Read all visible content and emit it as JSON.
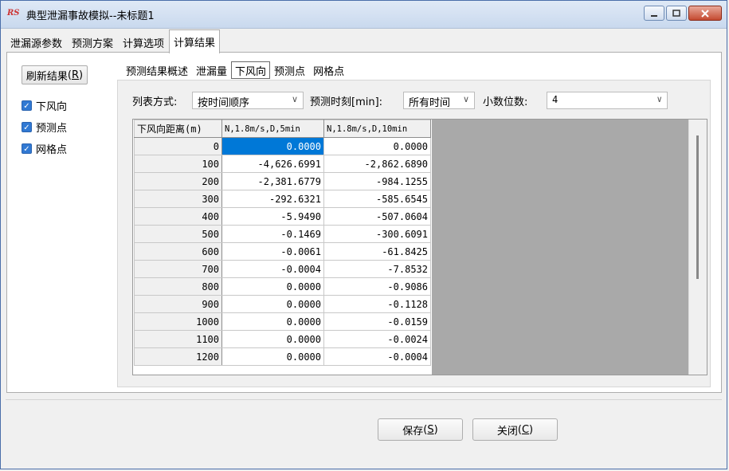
{
  "window": {
    "title": "典型泄漏事故模拟--未标题1",
    "logo": "RS"
  },
  "main_tabs": [
    "泄漏源参数",
    "预测方案",
    "计算选项",
    "计算结果"
  ],
  "active_main_tab": "计算结果",
  "left": {
    "refresh_label": "刷新结果",
    "refresh_hotkey": "R",
    "checkboxes": [
      {
        "label": "下风向",
        "checked": true
      },
      {
        "label": "预测点",
        "checked": true
      },
      {
        "label": "网格点",
        "checked": true
      }
    ]
  },
  "sub_tabs": [
    "预测结果概述",
    "泄漏量",
    "下风向",
    "预测点",
    "网格点"
  ],
  "active_sub_tab": "下风向",
  "options": {
    "list_mode_label": "列表方式:",
    "list_mode_value": "按时间顺序",
    "time_label": "预测时刻[min]:",
    "time_value": "所有时间",
    "decimals_label": "小数位数:",
    "decimals_value": "4"
  },
  "table": {
    "columns": [
      "下风向距离(m)",
      "N,1.8m/s,D,5min",
      "N,1.8m/s,D,10min"
    ],
    "rows": [
      [
        "0",
        "0.0000",
        "0.0000"
      ],
      [
        "100",
        "-4,626.6991",
        "-2,862.6890"
      ],
      [
        "200",
        "-2,381.6779",
        "-984.1255"
      ],
      [
        "300",
        "-292.6321",
        "-585.6545"
      ],
      [
        "400",
        "-5.9490",
        "-507.0604"
      ],
      [
        "500",
        "-0.1469",
        "-300.6091"
      ],
      [
        "600",
        "-0.0061",
        "-61.8425"
      ],
      [
        "700",
        "-0.0004",
        "-7.8532"
      ],
      [
        "800",
        "0.0000",
        "-0.9086"
      ],
      [
        "900",
        "0.0000",
        "-0.1128"
      ],
      [
        "1000",
        "0.0000",
        "-0.0159"
      ],
      [
        "1100",
        "0.0000",
        "-0.0024"
      ],
      [
        "1200",
        "0.0000",
        "-0.0004"
      ]
    ]
  },
  "buttons": {
    "save_label": "保存",
    "save_hotkey": "S",
    "close_label": "关闭",
    "close_hotkey": "C"
  }
}
